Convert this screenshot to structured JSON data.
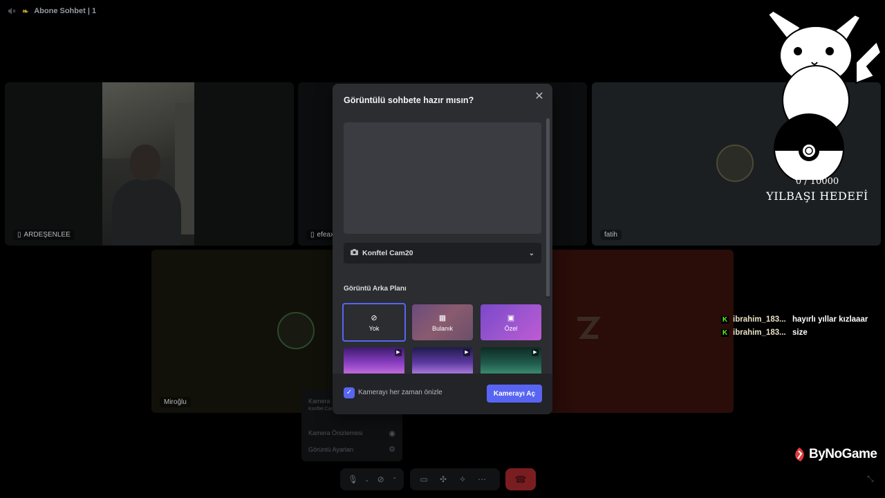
{
  "topbar": {
    "channel_name": "Abone Sohbet | 1"
  },
  "tiles": {
    "ardesenlee": {
      "label": "ARDEŞENLEE"
    },
    "efeax": {
      "label": "efeax"
    },
    "fatih": {
      "label": "fatih"
    },
    "miroglu": {
      "label": "Miroğlu"
    }
  },
  "modal": {
    "title": "Görüntülü sohbete hazır mısın?",
    "camera_select": {
      "value": "Konftel Cam20"
    },
    "background_section_title": "Görüntü Arka Planı",
    "background_options": [
      {
        "label": "Yok",
        "icon": "none-icon"
      },
      {
        "label": "Bulanık",
        "icon": "blur-icon"
      },
      {
        "label": "Özel",
        "icon": "custom-image-icon"
      }
    ],
    "always_preview_label": "Kamerayı her zaman önizle",
    "always_preview_checked": true,
    "turn_on_camera_label": "Kamerayı Aç"
  },
  "popup_menu": {
    "items": [
      "Kamera",
      "Konftel Cam20",
      "Kamera Önizlemesi",
      "Görüntü Ayarları"
    ]
  },
  "overlay": {
    "goal_count": "0 / 10000",
    "goal_title": "YILBAŞI HEDEFİ",
    "chat": [
      {
        "user": "ibrahim_183...",
        "message": "hayırlı yıllar kızlaaar"
      },
      {
        "user": "ibrahim_183...",
        "message": "size"
      }
    ],
    "brand": "ByNoGame"
  },
  "colors": {
    "accent": "#5865f2",
    "kick_green": "#53fc18",
    "modal_bg": "#2b2d31"
  }
}
